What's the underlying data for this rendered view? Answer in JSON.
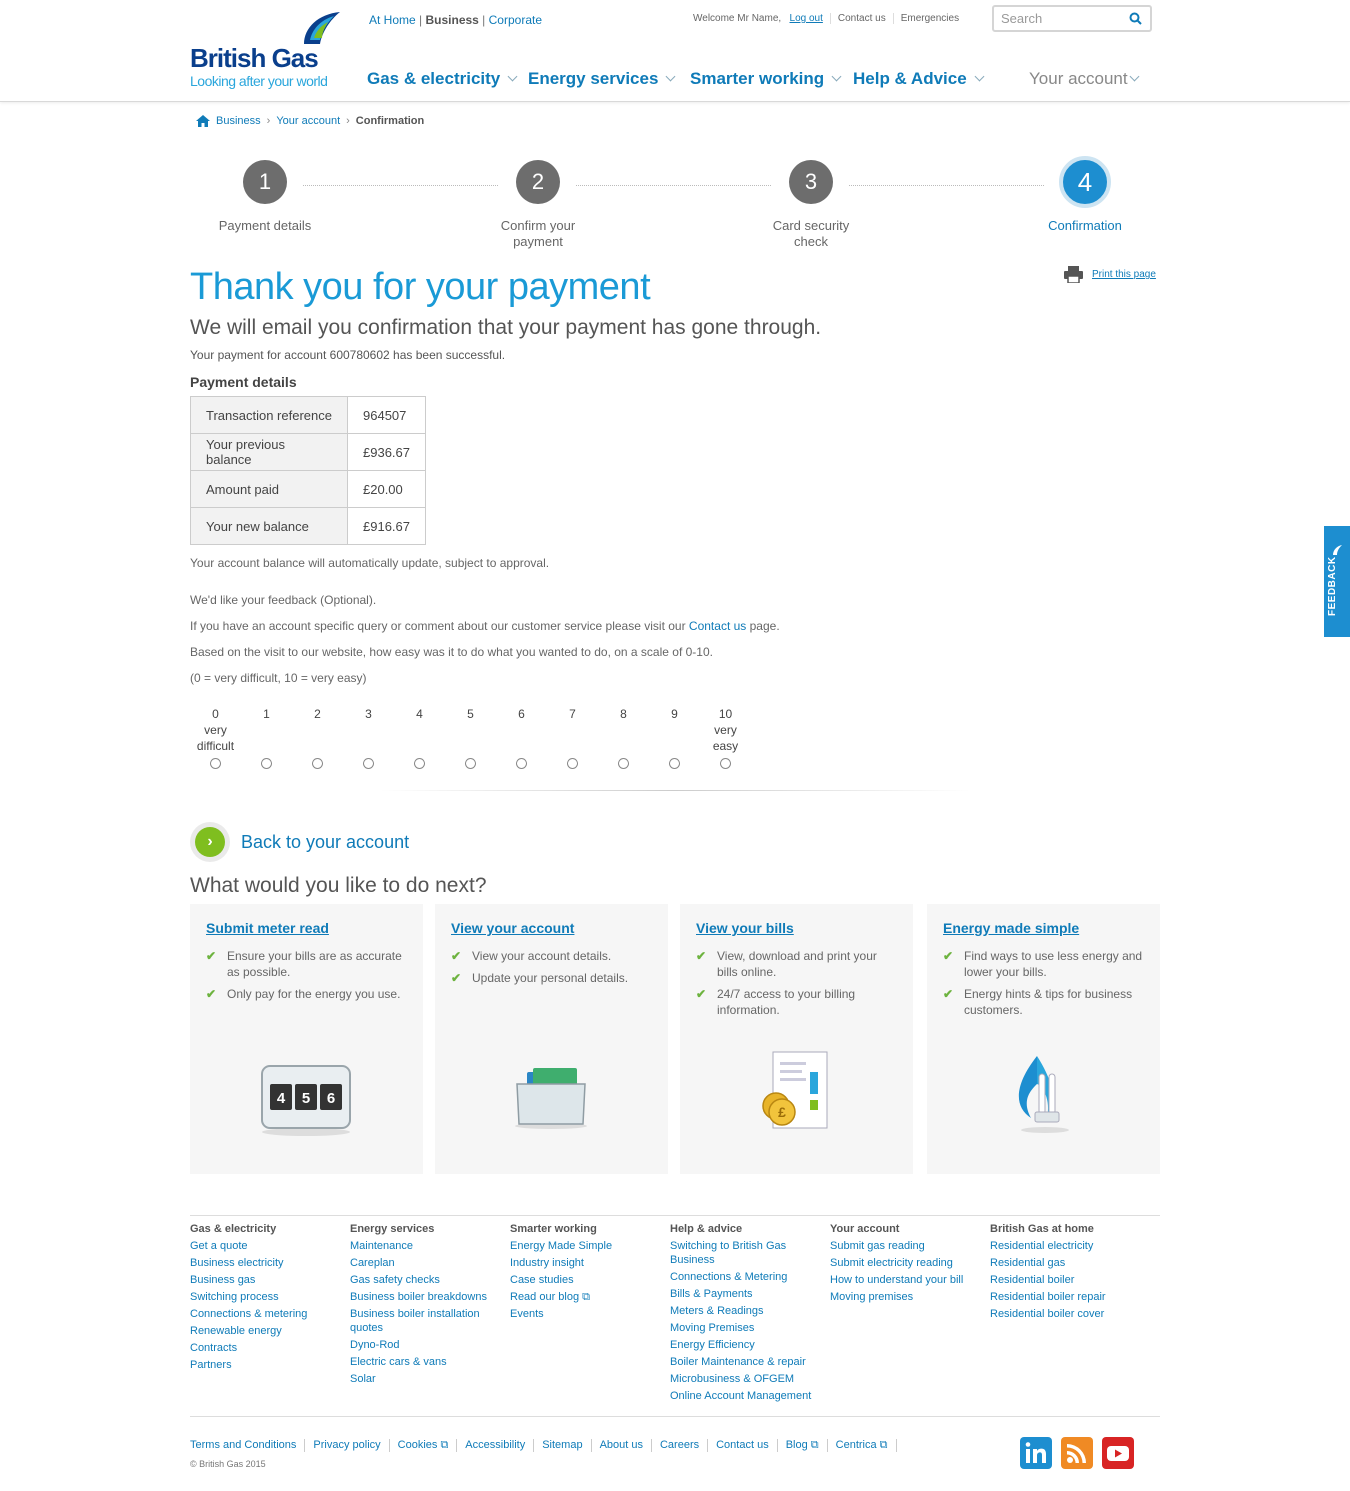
{
  "header": {
    "logo_text": "British Gas",
    "logo_tagline": "Looking after your world",
    "site_switch": {
      "home": "At Home",
      "business": "Business",
      "corporate": "Corporate"
    },
    "welcome": "Welcome Mr Name,",
    "logout": "Log out",
    "contact": "Contact us",
    "emergencies": "Emergencies",
    "search_placeholder": "Search",
    "nav": [
      "Gas & electricity",
      "Energy services",
      "Smarter working",
      "Help & Advice",
      "Your account"
    ]
  },
  "breadcrumb": {
    "items": [
      "Business",
      "Your account"
    ],
    "current": "Confirmation"
  },
  "steps": [
    {
      "number": "1",
      "label": "Payment details"
    },
    {
      "number": "2",
      "label": "Confirm your payment"
    },
    {
      "number": "3",
      "label": "Card security check"
    },
    {
      "number": "4",
      "label": "Confirmation"
    }
  ],
  "active_step": 4,
  "main": {
    "title": "Thank you for your payment",
    "print": "Print this page",
    "subtitle": "We will email you confirmation that your payment has gone through.",
    "account_message": "Your payment for account 600780602 has been successful.",
    "details_title": "Payment details",
    "details": [
      {
        "label": "Transaction reference",
        "value": "964507"
      },
      {
        "label": "Your previous balance",
        "value": "£936.67"
      },
      {
        "label": "Amount paid",
        "value": "£20.00"
      },
      {
        "label": "Your new balance",
        "value": "£916.67"
      }
    ],
    "balance_note": "Your account balance will automatically update, subject to approval.",
    "feedback_intro": "We'd like your feedback (Optional).",
    "query_before": "If you have an account specific query or comment about our customer service please visit our ",
    "query_link": "Contact us",
    "query_after": " page.",
    "scale_question": "Based on the visit to our website, how easy was it to do what you wanted to do, on a scale of 0-10.",
    "scale_legend": "(0 = very difficult, 10 = very easy)",
    "scale": [
      {
        "n": "0",
        "sub": "very difficult"
      },
      {
        "n": "1",
        "sub": ""
      },
      {
        "n": "2",
        "sub": ""
      },
      {
        "n": "3",
        "sub": ""
      },
      {
        "n": "4",
        "sub": ""
      },
      {
        "n": "5",
        "sub": ""
      },
      {
        "n": "6",
        "sub": ""
      },
      {
        "n": "7",
        "sub": ""
      },
      {
        "n": "8",
        "sub": ""
      },
      {
        "n": "9",
        "sub": ""
      },
      {
        "n": "10",
        "sub": "very easy"
      }
    ],
    "back_link": "Back to your account",
    "next_title": "What would you like to do next?"
  },
  "cards": [
    {
      "title": "Submit meter read",
      "items": [
        "Ensure your bills are as accurate as possible.",
        "Only pay for the energy you use."
      ],
      "icon": "meter-icon"
    },
    {
      "title": "View your account",
      "items": [
        "View your account details.",
        "Update your personal details."
      ],
      "icon": "folder-icon"
    },
    {
      "title": "View your bills",
      "items": [
        "View, download and print your bills online.",
        " 24/7 access to your billing information."
      ],
      "icon": "bill-icon"
    },
    {
      "title": "Energy made simple",
      "items": [
        "Find ways to use less energy and lower your bills.",
        "Energy hints & tips for business customers."
      ],
      "icon": "flame-bulb-icon"
    }
  ],
  "meter_digits": [
    "4",
    "5",
    "6"
  ],
  "footer": {
    "columns": [
      {
        "title": "Gas & electricity",
        "links": [
          "Get a quote",
          "Business electricity",
          "Business gas",
          "Switching process",
          "Connections & metering",
          "Renewable energy",
          "Contracts",
          "Partners"
        ]
      },
      {
        "title": "Energy services",
        "links": [
          "Maintenance",
          "Careplan",
          "Gas safety checks",
          "Business boiler breakdowns",
          "Business boiler installation quotes",
          "Dyno-Rod",
          "Electric cars & vans",
          "Solar"
        ]
      },
      {
        "title": "Smarter working",
        "links": [
          "Energy Made Simple",
          "Industry insight",
          "Case studies",
          "Read our blog ⧉",
          "Events"
        ]
      },
      {
        "title": "Help & advice",
        "links": [
          "Switching to British Gas Business",
          "Connections & Metering",
          "Bills & Payments",
          "Meters & Readings",
          "Moving Premises",
          "Energy Efficiency",
          "Boiler Maintenance & repair",
          "Microbusiness & OFGEM",
          "Online Account Management"
        ]
      },
      {
        "title": "Your account",
        "links": [
          "Submit gas reading",
          "Submit electricity reading",
          "How to understand your bill",
          "Moving premises"
        ]
      },
      {
        "title": "British Gas at home",
        "links": [
          "Residential electricity",
          "Residential gas",
          "Residential boiler",
          "Residential boiler repair",
          "Residential boiler cover"
        ]
      }
    ],
    "bottom_links": [
      "Terms and Conditions",
      "Privacy policy",
      "Cookies ⧉",
      "Accessibility",
      "Sitemap",
      "About us",
      "Careers",
      "Contact us",
      "Blog ⧉",
      "Centrica ⧉"
    ],
    "copyright": "© British Gas 2015"
  },
  "feedback_tab": "FEEDBACK",
  "colors": {
    "brand_blue": "#1a9ad6",
    "link": "#0f7bb8",
    "step_grey": "#6d6d6d",
    "tick_green": "#6db33f"
  }
}
